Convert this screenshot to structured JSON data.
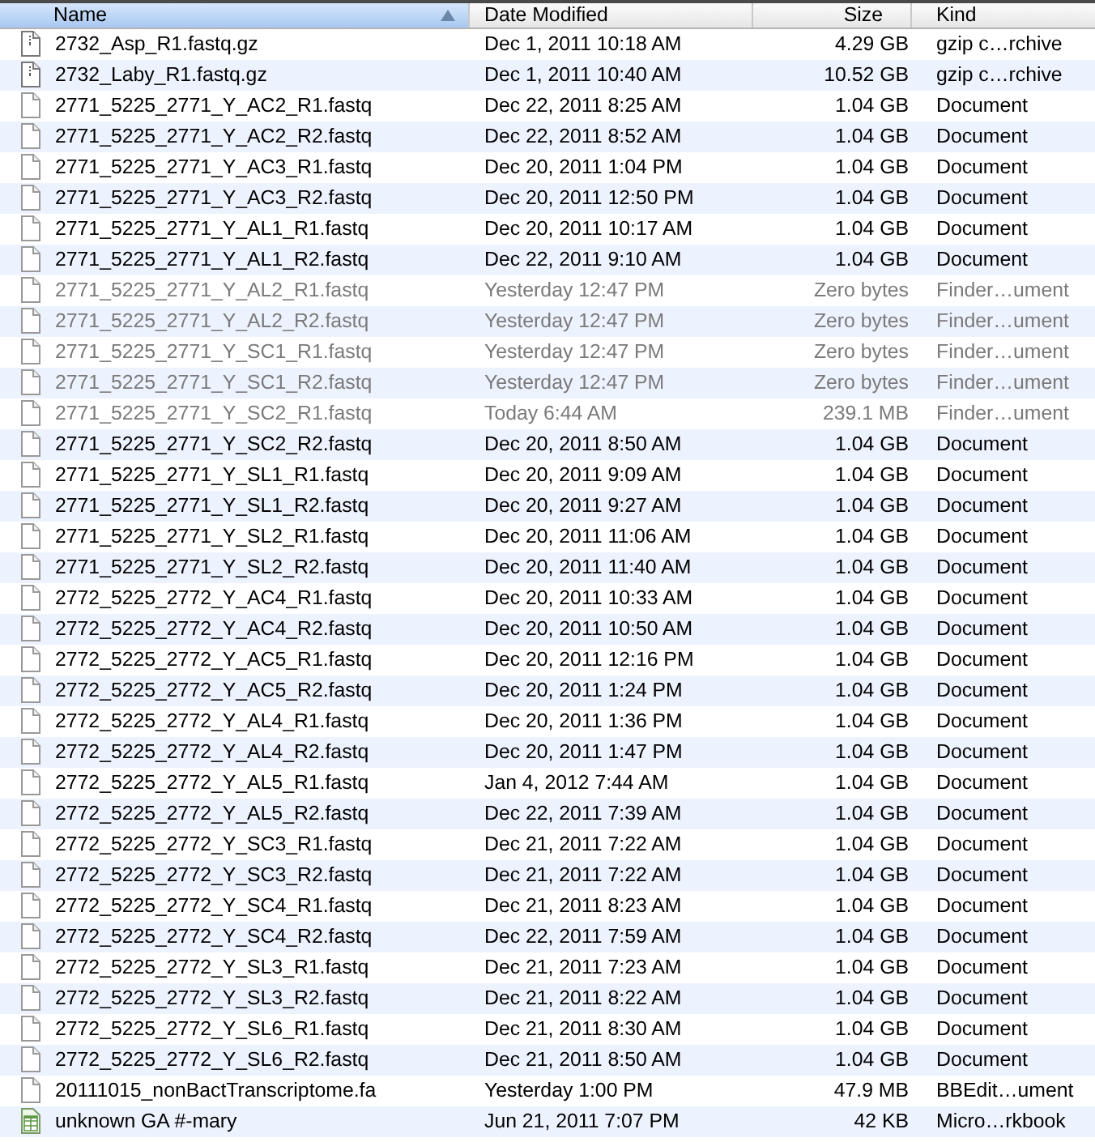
{
  "columns": [
    {
      "label": "Name",
      "sorted": true
    },
    {
      "label": "Date Modified",
      "sorted": false
    },
    {
      "label": "Size",
      "sorted": false
    },
    {
      "label": "Kind",
      "sorted": false
    }
  ],
  "files": [
    {
      "name": "2732_Asp_R1.fastq.gz",
      "date": "Dec 1, 2011 10:18 AM",
      "size": "4.29 GB",
      "kind_text": "gzip c…rchive",
      "kind": "archive",
      "dimmed": false
    },
    {
      "name": "2732_Laby_R1.fastq.gz",
      "date": "Dec 1, 2011 10:40 AM",
      "size": "10.52 GB",
      "kind_text": "gzip c…rchive",
      "kind": "archive",
      "dimmed": false
    },
    {
      "name": "2771_5225_2771_Y_AC2_R1.fastq",
      "date": "Dec 22, 2011 8:25 AM",
      "size": "1.04 GB",
      "kind_text": "Document",
      "kind": "document",
      "dimmed": false
    },
    {
      "name": "2771_5225_2771_Y_AC2_R2.fastq",
      "date": "Dec 22, 2011 8:52 AM",
      "size": "1.04 GB",
      "kind_text": "Document",
      "kind": "document",
      "dimmed": false
    },
    {
      "name": "2771_5225_2771_Y_AC3_R1.fastq",
      "date": "Dec 20, 2011 1:04 PM",
      "size": "1.04 GB",
      "kind_text": "Document",
      "kind": "document",
      "dimmed": false
    },
    {
      "name": "2771_5225_2771_Y_AC3_R2.fastq",
      "date": "Dec 20, 2011 12:50 PM",
      "size": "1.04 GB",
      "kind_text": "Document",
      "kind": "document",
      "dimmed": false
    },
    {
      "name": "2771_5225_2771_Y_AL1_R1.fastq",
      "date": "Dec 20, 2011 10:17 AM",
      "size": "1.04 GB",
      "kind_text": "Document",
      "kind": "document",
      "dimmed": false
    },
    {
      "name": "2771_5225_2771_Y_AL1_R2.fastq",
      "date": "Dec 22, 2011 9:10 AM",
      "size": "1.04 GB",
      "kind_text": "Document",
      "kind": "document",
      "dimmed": false
    },
    {
      "name": "2771_5225_2771_Y_AL2_R1.fastq",
      "date": "Yesterday 12:47 PM",
      "size": "Zero bytes",
      "kind_text": "Finder…ument",
      "kind": "document",
      "dimmed": true
    },
    {
      "name": "2771_5225_2771_Y_AL2_R2.fastq",
      "date": "Yesterday 12:47 PM",
      "size": "Zero bytes",
      "kind_text": "Finder…ument",
      "kind": "document",
      "dimmed": true
    },
    {
      "name": "2771_5225_2771_Y_SC1_R1.fastq",
      "date": "Yesterday 12:47 PM",
      "size": "Zero bytes",
      "kind_text": "Finder…ument",
      "kind": "document",
      "dimmed": true
    },
    {
      "name": "2771_5225_2771_Y_SC1_R2.fastq",
      "date": "Yesterday 12:47 PM",
      "size": "Zero bytes",
      "kind_text": "Finder…ument",
      "kind": "document",
      "dimmed": true
    },
    {
      "name": "2771_5225_2771_Y_SC2_R1.fastq",
      "date": "Today 6:44 AM",
      "size": "239.1 MB",
      "kind_text": "Finder…ument",
      "kind": "document",
      "dimmed": true
    },
    {
      "name": "2771_5225_2771_Y_SC2_R2.fastq",
      "date": "Dec 20, 2011 8:50 AM",
      "size": "1.04 GB",
      "kind_text": "Document",
      "kind": "document",
      "dimmed": false
    },
    {
      "name": "2771_5225_2771_Y_SL1_R1.fastq",
      "date": "Dec 20, 2011 9:09 AM",
      "size": "1.04 GB",
      "kind_text": "Document",
      "kind": "document",
      "dimmed": false
    },
    {
      "name": "2771_5225_2771_Y_SL1_R2.fastq",
      "date": "Dec 20, 2011 9:27 AM",
      "size": "1.04 GB",
      "kind_text": "Document",
      "kind": "document",
      "dimmed": false
    },
    {
      "name": "2771_5225_2771_Y_SL2_R1.fastq",
      "date": "Dec 20, 2011 11:06 AM",
      "size": "1.04 GB",
      "kind_text": "Document",
      "kind": "document",
      "dimmed": false
    },
    {
      "name": "2771_5225_2771_Y_SL2_R2.fastq",
      "date": "Dec 20, 2011 11:40 AM",
      "size": "1.04 GB",
      "kind_text": "Document",
      "kind": "document",
      "dimmed": false
    },
    {
      "name": "2772_5225_2772_Y_AC4_R1.fastq",
      "date": "Dec 20, 2011 10:33 AM",
      "size": "1.04 GB",
      "kind_text": "Document",
      "kind": "document",
      "dimmed": false
    },
    {
      "name": "2772_5225_2772_Y_AC4_R2.fastq",
      "date": "Dec 20, 2011 10:50 AM",
      "size": "1.04 GB",
      "kind_text": "Document",
      "kind": "document",
      "dimmed": false
    },
    {
      "name": "2772_5225_2772_Y_AC5_R1.fastq",
      "date": "Dec 20, 2011 12:16 PM",
      "size": "1.04 GB",
      "kind_text": "Document",
      "kind": "document",
      "dimmed": false
    },
    {
      "name": "2772_5225_2772_Y_AC5_R2.fastq",
      "date": "Dec 20, 2011 1:24 PM",
      "size": "1.04 GB",
      "kind_text": "Document",
      "kind": "document",
      "dimmed": false
    },
    {
      "name": "2772_5225_2772_Y_AL4_R1.fastq",
      "date": "Dec 20, 2011 1:36 PM",
      "size": "1.04 GB",
      "kind_text": "Document",
      "kind": "document",
      "dimmed": false
    },
    {
      "name": "2772_5225_2772_Y_AL4_R2.fastq",
      "date": "Dec 20, 2011 1:47 PM",
      "size": "1.04 GB",
      "kind_text": "Document",
      "kind": "document",
      "dimmed": false
    },
    {
      "name": "2772_5225_2772_Y_AL5_R1.fastq",
      "date": "Jan 4, 2012 7:44 AM",
      "size": "1.04 GB",
      "kind_text": "Document",
      "kind": "document",
      "dimmed": false
    },
    {
      "name": "2772_5225_2772_Y_AL5_R2.fastq",
      "date": "Dec 22, 2011 7:39 AM",
      "size": "1.04 GB",
      "kind_text": "Document",
      "kind": "document",
      "dimmed": false
    },
    {
      "name": "2772_5225_2772_Y_SC3_R1.fastq",
      "date": "Dec 21, 2011 7:22 AM",
      "size": "1.04 GB",
      "kind_text": "Document",
      "kind": "document",
      "dimmed": false
    },
    {
      "name": "2772_5225_2772_Y_SC3_R2.fastq",
      "date": "Dec 21, 2011 7:22 AM",
      "size": "1.04 GB",
      "kind_text": "Document",
      "kind": "document",
      "dimmed": false
    },
    {
      "name": "2772_5225_2772_Y_SC4_R1.fastq",
      "date": "Dec 21, 2011 8:23 AM",
      "size": "1.04 GB",
      "kind_text": "Document",
      "kind": "document",
      "dimmed": false
    },
    {
      "name": "2772_5225_2772_Y_SC4_R2.fastq",
      "date": "Dec 22, 2011 7:59 AM",
      "size": "1.04 GB",
      "kind_text": "Document",
      "kind": "document",
      "dimmed": false
    },
    {
      "name": "2772_5225_2772_Y_SL3_R1.fastq",
      "date": "Dec 21, 2011 7:23 AM",
      "size": "1.04 GB",
      "kind_text": "Document",
      "kind": "document",
      "dimmed": false
    },
    {
      "name": "2772_5225_2772_Y_SL3_R2.fastq",
      "date": "Dec 21, 2011 8:22 AM",
      "size": "1.04 GB",
      "kind_text": "Document",
      "kind": "document",
      "dimmed": false
    },
    {
      "name": "2772_5225_2772_Y_SL6_R1.fastq",
      "date": "Dec 21, 2011 8:30 AM",
      "size": "1.04 GB",
      "kind_text": "Document",
      "kind": "document",
      "dimmed": false
    },
    {
      "name": "2772_5225_2772_Y_SL6_R2.fastq",
      "date": "Dec 21, 2011 8:50 AM",
      "size": "1.04 GB",
      "kind_text": "Document",
      "kind": "document",
      "dimmed": false
    },
    {
      "name": "20111015_nonBactTranscriptome.fa",
      "date": "Yesterday 1:00 PM",
      "size": "47.9 MB",
      "kind_text": "BBEdit…ument",
      "kind": "document",
      "dimmed": false
    },
    {
      "name": "unknown GA #-mary",
      "date": "Jun 21, 2011 7:07 PM",
      "size": "42 KB",
      "kind_text": "Micro…rkbook",
      "kind": "spreadsheet",
      "dimmed": false
    }
  ]
}
